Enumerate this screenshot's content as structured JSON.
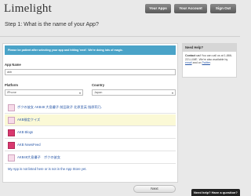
{
  "app": {
    "logo": "Limelight"
  },
  "nav": {
    "your_apps": "Your Apps",
    "your_account": "Your Account",
    "sign_out": "Sign Out"
  },
  "step": {
    "title": "Step 1: What is the name of your App?"
  },
  "notice": "Please be patient after selecting your app and hitting 'next'. We're doing lots of magic.",
  "form": {
    "app_name_label": "App Name",
    "app_name_value": "akb",
    "platform_label": "Platform",
    "platform_value": "iPhone",
    "country_label": "Country",
    "country_value": "Japan"
  },
  "results": [
    {
      "name": "ボクの彼女 AKB48 大島優子 前田敦子 北原里英 指原莉乃.",
      "icon": "app-icon",
      "highlighted": false
    },
    {
      "name": "AKB検定クイズ",
      "icon": "app-icon",
      "highlighted": true
    },
    {
      "name": "AKB Blogs",
      "icon": "akb-logo-icon",
      "highlighted": false
    },
    {
      "name": "AKB NewsFeed",
      "icon": "akb-logo-icon",
      "highlighted": false
    },
    {
      "name": "AKB48大島優子　ボクの彼女",
      "icon": "app-icon",
      "highlighted": false
    }
  ],
  "not_listed": "My App is not listed here or is not in the App Store yet.",
  "next_label": "Next",
  "help": {
    "title": "Need Help?",
    "line1_strong": "Contact us!",
    "line1_rest": " You can call us at 1-866-221-LIME. We're also available by ",
    "email": "email",
    "and_on": " and on ",
    "twitter": "Twitter",
    "period": "."
  },
  "help_tab": "Need help? Have a question?"
}
